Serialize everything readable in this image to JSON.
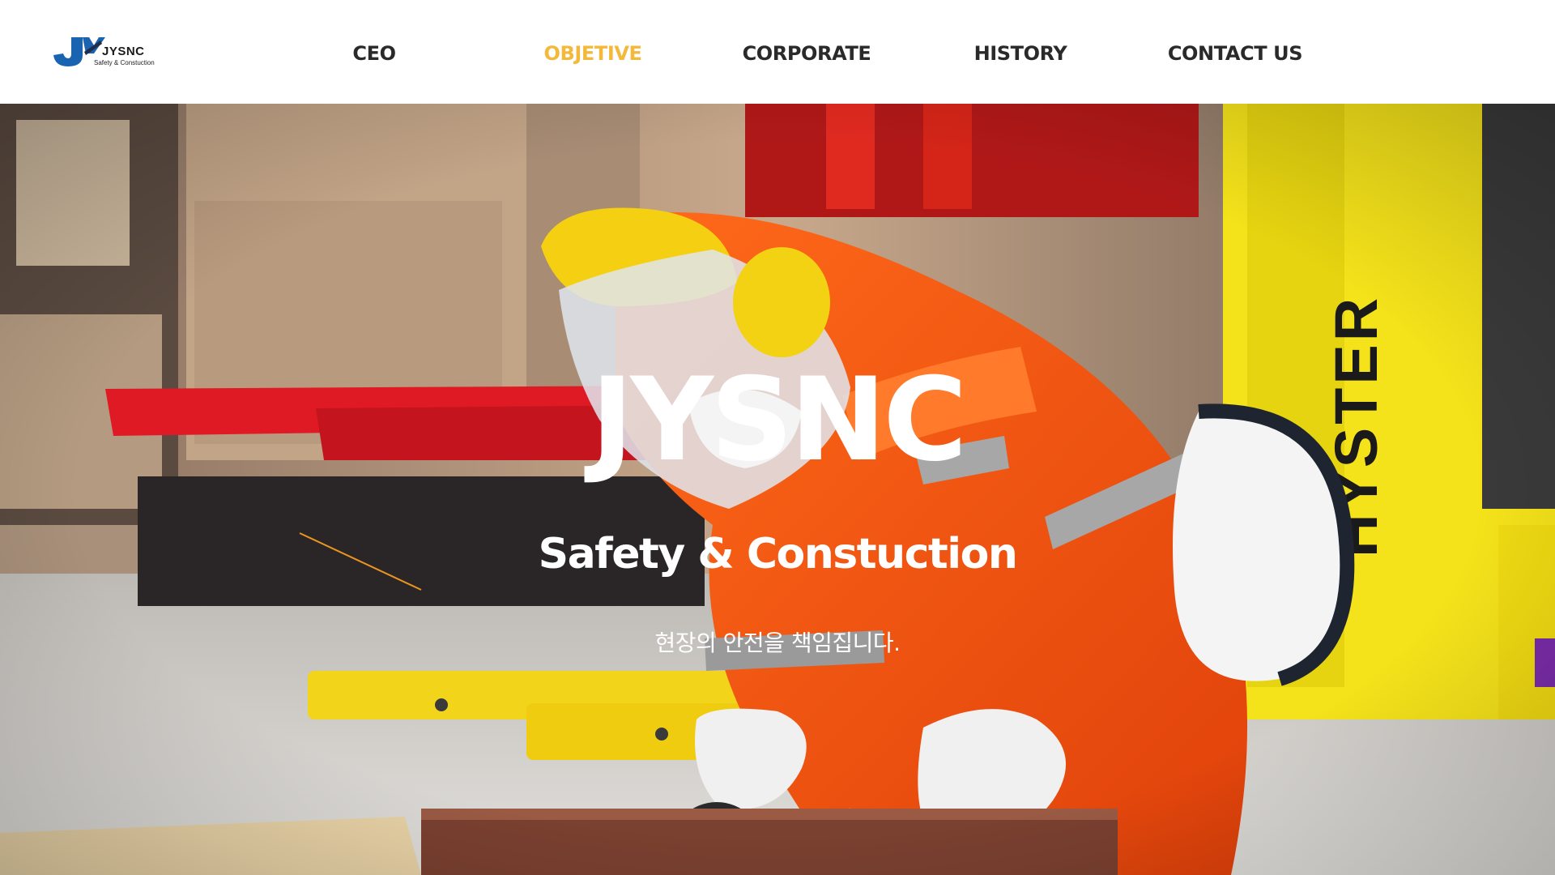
{
  "header": {
    "logo": {
      "name": "JYSNC",
      "tagline": "Safety & Constuction",
      "icon": "jysnc-logo-mark",
      "colors": {
        "mark_blue": "#1a63b0",
        "mark_dark": "#1f2e4a"
      }
    },
    "nav": {
      "items": [
        {
          "label": "CEO",
          "active": false
        },
        {
          "label": "OBJETIVE",
          "active": true
        },
        {
          "label": "CORPORATE",
          "active": false
        },
        {
          "label": "HISTORY",
          "active": false
        },
        {
          "label": "CONTACT US",
          "active": false
        }
      ]
    }
  },
  "hero": {
    "title": "JYSNC",
    "subtitle": "Safety & Constuction",
    "tagline": "현장의 안전을 책임집니다.",
    "background_image": "worker-with-angle-grinder-photo"
  },
  "colors": {
    "accent": "#f3b93a",
    "nav_text": "#2a2a2a",
    "header_bg": "#ffffff",
    "hero_text": "#ffffff"
  }
}
